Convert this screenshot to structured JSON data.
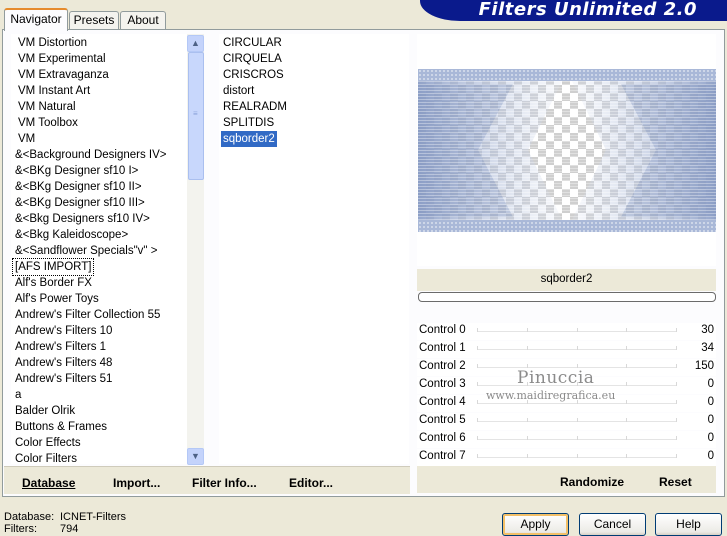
{
  "app_title": "Filters Unlimited 2.0",
  "tabs": [
    {
      "label": "Navigator",
      "active": true
    },
    {
      "label": "Presets",
      "active": false
    },
    {
      "label": "About",
      "active": false
    }
  ],
  "categories": [
    "VM Distortion",
    "VM Experimental",
    "VM Extravaganza",
    "VM Instant Art",
    "VM Natural",
    "VM Toolbox",
    "VM",
    "&<Background Designers IV>",
    "&<BKg Designer sf10 I>",
    "&<BKg Designer sf10 II>",
    "&<BKg Designer sf10 III>",
    "&<Bkg Designers sf10 IV>",
    "&<Bkg Kaleidoscope>",
    "&<Sandflower Specials\"v\" >",
    "[AFS IMPORT]",
    "Alf's Border FX",
    "Alf's Power Toys",
    "Andrew's Filter Collection 55",
    "Andrew's Filters 10",
    "Andrew's Filters 1",
    "Andrew's Filters 48",
    "Andrew's Filters 51",
    "a",
    "Balder Olrik",
    "Buttons & Frames",
    "Color Effects",
    "Color Filters"
  ],
  "selected_category": "[AFS IMPORT]",
  "filters": [
    "CIRCULAR",
    "CIRQUELA",
    "CRISCROS",
    "distort",
    "REALRADM",
    "SPLITDIS",
    "sqborder2"
  ],
  "selected_filter": "sqborder2",
  "left_buttons": {
    "database": "Database",
    "import": "Import...",
    "filter_info": "Filter Info...",
    "editor": "Editor..."
  },
  "preview_filter_name": "sqborder2",
  "controls": [
    {
      "name": "Control 0",
      "value": "30"
    },
    {
      "name": "Control 1",
      "value": "34"
    },
    {
      "name": "Control 2",
      "value": "150"
    },
    {
      "name": "Control 3",
      "value": "0"
    },
    {
      "name": "Control 4",
      "value": "0"
    },
    {
      "name": "Control 5",
      "value": "0"
    },
    {
      "name": "Control 6",
      "value": "0"
    },
    {
      "name": "Control 7",
      "value": "0"
    }
  ],
  "watermark": {
    "line1": "Pinuccia",
    "line2": "www.maidiregrafica.eu"
  },
  "right_buttons": {
    "randomize": "Randomize",
    "reset": "Reset"
  },
  "status": {
    "database_label": "Database:",
    "database_value": "ICNET-Filters",
    "filters_label": "Filters:",
    "filters_value": "794"
  },
  "dialog_buttons": {
    "apply": "Apply",
    "cancel": "Cancel",
    "help": "Help"
  },
  "colors": {
    "selection": "#316ac5",
    "banner": "#0a1a8c",
    "dialog_bg": "#ece9d8",
    "preview_blue": "#a9b8d8"
  }
}
